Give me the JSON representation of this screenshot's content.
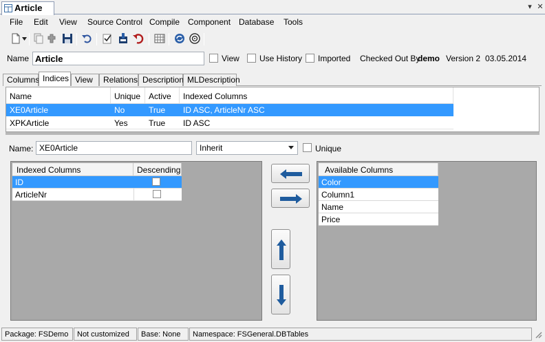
{
  "document": {
    "tab_title": "Article",
    "pin_glyph": "▾",
    "close_glyph": "✕"
  },
  "menu": [
    "File",
    "Edit",
    "View",
    "Source Control",
    "Compile",
    "Component",
    "Database",
    "Tools"
  ],
  "toolbar": {
    "icons": [
      "new-document-icon",
      "dropdown-arrow-icon",
      "copy-icon",
      "plugin-icon",
      "save-icon",
      "undo-icon",
      "checklist-icon",
      "check-in-icon",
      "revert-icon",
      "calendar-grid-icon",
      "refresh-sync-icon",
      "target-icon"
    ]
  },
  "name_row": {
    "label": "Name",
    "value": "Article",
    "view_label": "View",
    "use_history_label": "Use History",
    "imported_label": "Imported",
    "checked_out_label": "Checked Out By",
    "checked_out_user": "demo",
    "version": "Version 2",
    "date": "03.05.2014"
  },
  "tabs": [
    "Columns",
    "Indices",
    "View",
    "Relations",
    "Description",
    "MLDescription"
  ],
  "active_tab": "Indices",
  "indices_grid": {
    "headers": [
      "Name",
      "Unique",
      "Active",
      "Indexed Columns"
    ],
    "rows": [
      {
        "name": "XE0Article",
        "unique": "No",
        "active": "True",
        "columns": "ID ASC, ArticleNr ASC",
        "selected": true
      },
      {
        "name": "XPKArticle",
        "unique": "Yes",
        "active": "True",
        "columns": "ID ASC",
        "selected": false
      }
    ]
  },
  "edit": {
    "name_label": "Name:",
    "name_value": "XE0Article",
    "mode_value": "Inherit",
    "unique_label": "Unique"
  },
  "indexed_columns": {
    "header": "Indexed Columns",
    "descending_header": "Descending",
    "rows": [
      {
        "name": "ID",
        "selected": true
      },
      {
        "name": "ArticleNr",
        "selected": false
      }
    ]
  },
  "available_columns": {
    "header": "Available Columns",
    "rows": [
      {
        "name": "Color",
        "selected": true
      },
      {
        "name": "Column1",
        "selected": false
      },
      {
        "name": "Name",
        "selected": false
      },
      {
        "name": "Price",
        "selected": false
      }
    ]
  },
  "move_buttons": [
    "arrow-left-icon",
    "arrow-right-icon",
    "arrow-up-icon",
    "arrow-down-icon"
  ],
  "status_bar": {
    "package": "Package: FSDemo",
    "customized": "Not customized",
    "base": "Base: None",
    "namespace": "Namespace: FSGeneral.DBTables"
  },
  "colors": {
    "selection": "#3399ff",
    "arrow_blue": "#1f5c9e",
    "panel_gray": "#a9a9a9"
  }
}
